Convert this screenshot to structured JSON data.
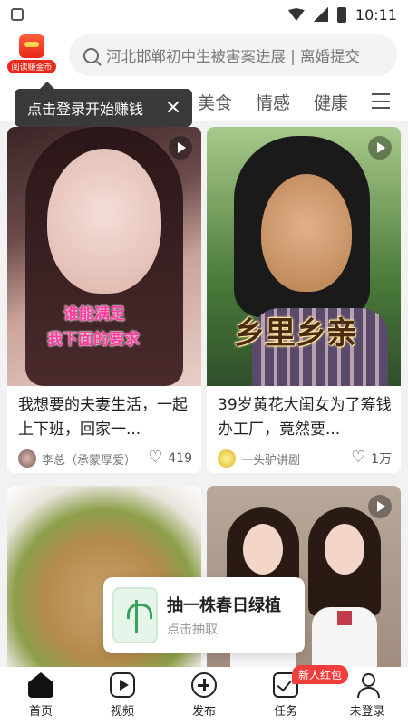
{
  "status_bar": {
    "time": "10:11"
  },
  "header": {
    "coin_label": "阅读赚金币",
    "search_placeholder": "河北邯郸初中生被害案进展 | 离婚提交"
  },
  "tabs": [
    "美食",
    "情感",
    "健康"
  ],
  "tooltip": {
    "text": "点击登录开始赚钱"
  },
  "feed": [
    {
      "title": "我想要的夫妻生活，一起上下班，回家一...",
      "author": "李总（承蒙厚爱）",
      "likes": "419",
      "overlay_lines": [
        "谁能满足",
        "我下面的要求"
      ]
    },
    {
      "title": "39岁黄花大闺女为了筹钱办工厂，竟然要...",
      "author": "一头驴讲剧",
      "likes": "1万",
      "overlay": "乡里乡亲"
    },
    {
      "title": "",
      "author": "",
      "likes": ""
    },
    {
      "title": "",
      "author": "",
      "likes": ""
    }
  ],
  "promo": {
    "title": "抽一株春日绿植",
    "subtitle": "点击抽取"
  },
  "bottom_nav": {
    "items": [
      {
        "label": "首页",
        "icon": "home-icon"
      },
      {
        "label": "视频",
        "icon": "video-icon"
      },
      {
        "label": "发布",
        "icon": "plus-circle-icon"
      },
      {
        "label": "任务",
        "icon": "task-icon"
      },
      {
        "label": "未登录",
        "icon": "user-icon"
      }
    ],
    "badge": "新人红包"
  },
  "colors": {
    "accent": "#e8281a",
    "badge": "#f23d3d",
    "overlay_pink": "#ff3b9e"
  }
}
